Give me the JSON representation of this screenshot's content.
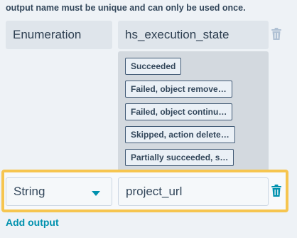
{
  "helper_text": "output name must be unique and can only be used once.",
  "outputs": [
    {
      "type": "Enumeration",
      "name": "hs_execution_state"
    },
    {
      "type": "String",
      "name": "project_url"
    }
  ],
  "enum_values": [
    "Succeeded",
    "Failed, object remove…",
    "Failed, object continu…",
    "Skipped, action delete…",
    "Partially succeeded, s…"
  ],
  "add_output_label": "Add output",
  "icons": {
    "delete": "trash-icon",
    "dropdown": "chevron-down-icon"
  },
  "colors": {
    "accent": "#0091ae",
    "highlight": "#f6c54f"
  }
}
